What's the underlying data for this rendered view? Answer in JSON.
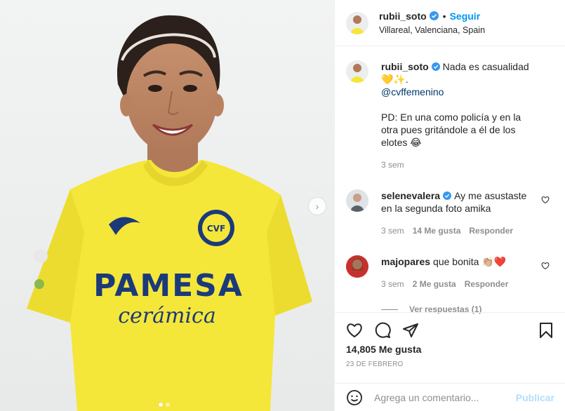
{
  "post": {
    "username": "rubii_soto",
    "follow_label": "Seguir",
    "separator": "•",
    "location": "Villareal, Valenciana, Spain",
    "caption": {
      "text": "Nada es casualidad 💛✨.",
      "mention": "@cvffemenino",
      "ps": "PD: En una como policía y en la otra pues gritándole a él de los elotes 😂",
      "time": "3 sem"
    },
    "photo": {
      "jersey_top_text": "PAMESA",
      "jersey_bottom_text": "cerámica",
      "badge_text": "CVF",
      "next_icon": "chevron-right-icon"
    },
    "likes": "14,805 Me gusta",
    "date": "23 DE FEBRERO"
  },
  "comments": [
    {
      "username": "selenevalera",
      "verified": true,
      "text": "Ay me asustaste en la segunda foto amika",
      "time": "3 sem",
      "likes": "14 Me gusta",
      "reply": "Responder"
    },
    {
      "username": "majopares",
      "verified": false,
      "text": "que bonita 👏🏼❤️",
      "time": "3 sem",
      "likes": "2 Me gusta",
      "reply": "Responder",
      "view_replies": "Ver respuestas (1)"
    }
  ],
  "composer": {
    "placeholder": "Agrega un comentario...",
    "post_label": "Publicar"
  },
  "colors": {
    "accent": "#0095f6",
    "jersey": "#f5e63a",
    "text_muted": "#8e8e8e"
  }
}
